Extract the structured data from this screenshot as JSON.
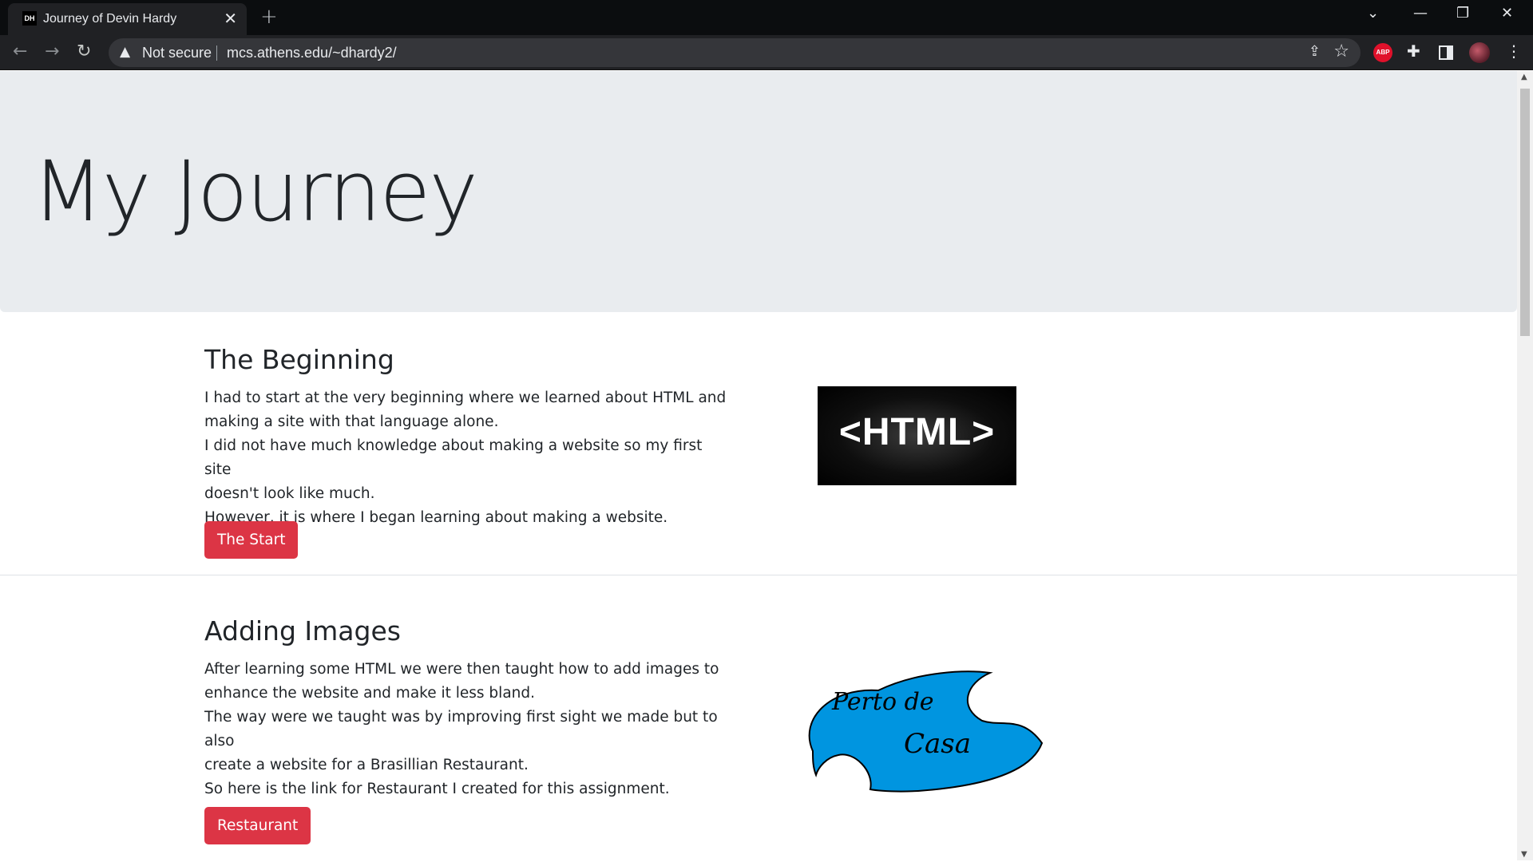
{
  "browser": {
    "tab_title": "Journey of Devin Hardy",
    "favicon_text": "DH",
    "address_security": "Not secure",
    "url": "mcs.athens.edu/~dhardy2/",
    "extension_abp": "ABP"
  },
  "page": {
    "heading": "My Journey",
    "sections": [
      {
        "title": "The Beginning",
        "paragraphs": [
          "I had to start at the very beginning where we learned about HTML and",
          "making a site with that language alone.",
          "I did not have much knowledge about making a website so my first site",
          "doesn't look like much.",
          "However, it is where I began learning about making a website."
        ],
        "button": "The Start",
        "image_text": "<HTML>"
      },
      {
        "title": "Adding Images",
        "paragraphs": [
          "After learning some HTML we were then taught how to add images to",
          "enhance the website and make it less bland.",
          "The way were we taught was by improving first sight we made but to also",
          "create a website for a Brasillian Restaurant.",
          "So here is the link for Restaurant I created for this assignment."
        ],
        "button": "Restaurant",
        "image_text_line1": "Perto de",
        "image_text_line2": "Casa"
      }
    ]
  },
  "colors": {
    "jumbotron_bg": "#e9ecef",
    "button_red": "#dc3545",
    "logo_blue": "#0095e0"
  }
}
